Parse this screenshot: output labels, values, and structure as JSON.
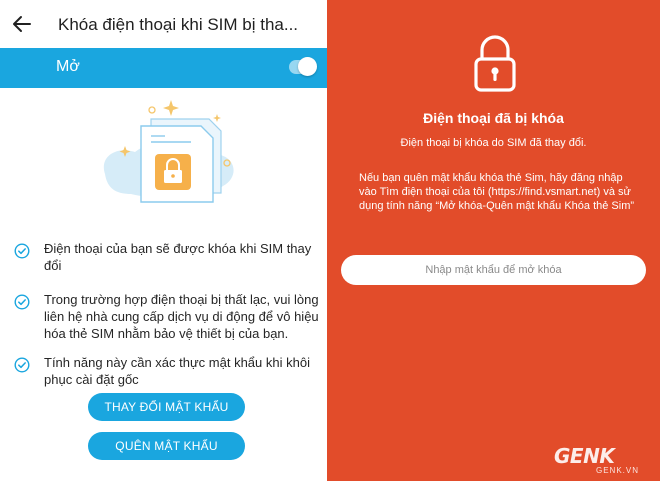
{
  "left_screen": {
    "header": {
      "title": "Khóa điện thoại khi SIM bị tha..."
    },
    "toggle": {
      "label": "Mở",
      "checked": true
    },
    "features": [
      {
        "text": "Điện thoại của bạn sẽ được khóa khi SIM thay đổi"
      },
      {
        "text": "Trong trường hợp điện thoại bị thất lạc, vui lòng liên hệ nhà cung cấp dịch vụ di động để vô hiệu hóa thẻ SIM nhằm bảo vệ thiết bị của bạn."
      },
      {
        "text": "Tính năng này cần xác thực mật khẩu khi khôi phục cài đặt gốc"
      }
    ],
    "buttons": {
      "change_password": "THAY ĐỔI MẬT KHẨU",
      "forgot_password": "QUÊN MẬT KHẨU"
    }
  },
  "right_screen": {
    "title": "Điện thoại đã bị khóa",
    "subtitle": "Điện thoại bị khóa do SIM đã thay đổi.",
    "description": "Nếu bạn quên mật khẩu khóa thẻ Sim, hãy đăng nhập vào Tìm điện thoại của tôi (https://find.vsmart.net) và sử dụng tính năng “Mở khóa-Quên mật khẩu Khóa thẻ Sim”",
    "password_placeholder": "Nhập mật khẩu để mở khóa"
  },
  "watermark": {
    "logo": "GENK",
    "sub": "GENK.VN"
  },
  "colors": {
    "accent_blue": "#1aa6df",
    "lock_red": "#e24c2a",
    "sim_orange": "#f6b04a"
  },
  "icons": {
    "back": "arrow-left-icon",
    "check": "check-circle-icon",
    "lock": "padlock-icon",
    "sim": "sim-card-lock-icon"
  }
}
